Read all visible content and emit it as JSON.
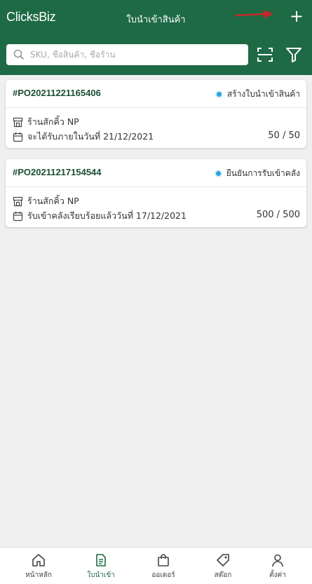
{
  "header": {
    "logo": "ClicksBiz",
    "title": "ใบนำเข้าสินค้า",
    "add_label": "+"
  },
  "search": {
    "placeholder": "SKU, ชื่อสินค้า, ชื่อร้าน"
  },
  "orders": [
    {
      "po_number": "#PO20211221165406",
      "status": "สร้างใบนำเข้าสินค้า",
      "store": "ร้านสักคิ้ว NP",
      "date_text": "จะได้รับภายในวันที่ 21/12/2021",
      "quantity": "50 / 50"
    },
    {
      "po_number": "#PO20211217154544",
      "status": "ยืนยันการรับเข้าคลัง",
      "store": "ร้านสักคิ้ว NP",
      "date_text": "รับเข้าคลังเรียบร้อยแล้ววันที่ 17/12/2021",
      "quantity": "500 / 500"
    }
  ],
  "nav": {
    "items": [
      {
        "label": "หน้าหลัก",
        "icon": "home-icon"
      },
      {
        "label": "ใบนำเข้า",
        "icon": "document-icon",
        "active": true
      },
      {
        "label": "ออเดอร์",
        "icon": "bag-icon"
      },
      {
        "label": "สต๊อก",
        "icon": "tag-icon"
      },
      {
        "label": "ตั้งค่า",
        "icon": "user-icon"
      }
    ]
  },
  "colors": {
    "header_bg": "#1e6a45",
    "status_dot": "#2aa6e0",
    "annotation_arrow": "#c62828"
  }
}
